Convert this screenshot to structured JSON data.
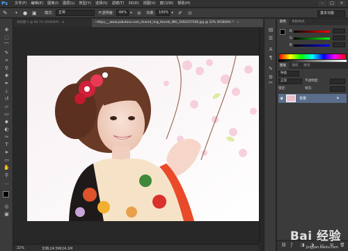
{
  "app": {
    "logo": "Ps"
  },
  "menu": [
    "文件(F)",
    "编辑(E)",
    "图像(I)",
    "图层(L)",
    "类型(Y)",
    "选择(S)",
    "滤镜(T)",
    "3D(D)",
    "视图(V)",
    "窗口(W)",
    "帮助(H)"
  ],
  "window_buttons": [
    "–",
    "□",
    "×"
  ],
  "options": {
    "style_label": "模式:",
    "style_value": "正常",
    "opacity_label": "不透明度:",
    "opacity_value": "66%",
    "flow_label": "流量:",
    "flow_value": "100%",
    "workspace": "基本功能"
  },
  "tabs": [
    {
      "label": "未标题-1 @ 66.7% (RGB/8#)",
      "close": "×",
      "active": false
    },
    {
      "label": "~https___www.pakutaso.com_shared_img_thumb_IMG_5092257508.jpg @ 22% (RGB/8#) *",
      "close": "×",
      "active": true
    }
  ],
  "status": {
    "zoom": "22%",
    "doc": "文档:24.5M/24.1M"
  },
  "panel": {
    "color_tabs": [
      "颜色",
      "色板样式"
    ],
    "rgb_labels": [
      "R",
      "G",
      "B"
    ],
    "layers_tabs": [
      "图层",
      "通道",
      "路径"
    ],
    "kind": "种类",
    "blend": "正常",
    "opacity_label": "不透明度:",
    "lock_label": "锁定:",
    "fill_label": "填充:",
    "layer_name": "背景"
  },
  "watermark": {
    "brand": "Bai 经验",
    "url": "jingyan.baidu.com"
  },
  "colors": {
    "accent": "#4aa5ff",
    "layer_selected": "#5a6e8c",
    "bg": "#282828"
  }
}
